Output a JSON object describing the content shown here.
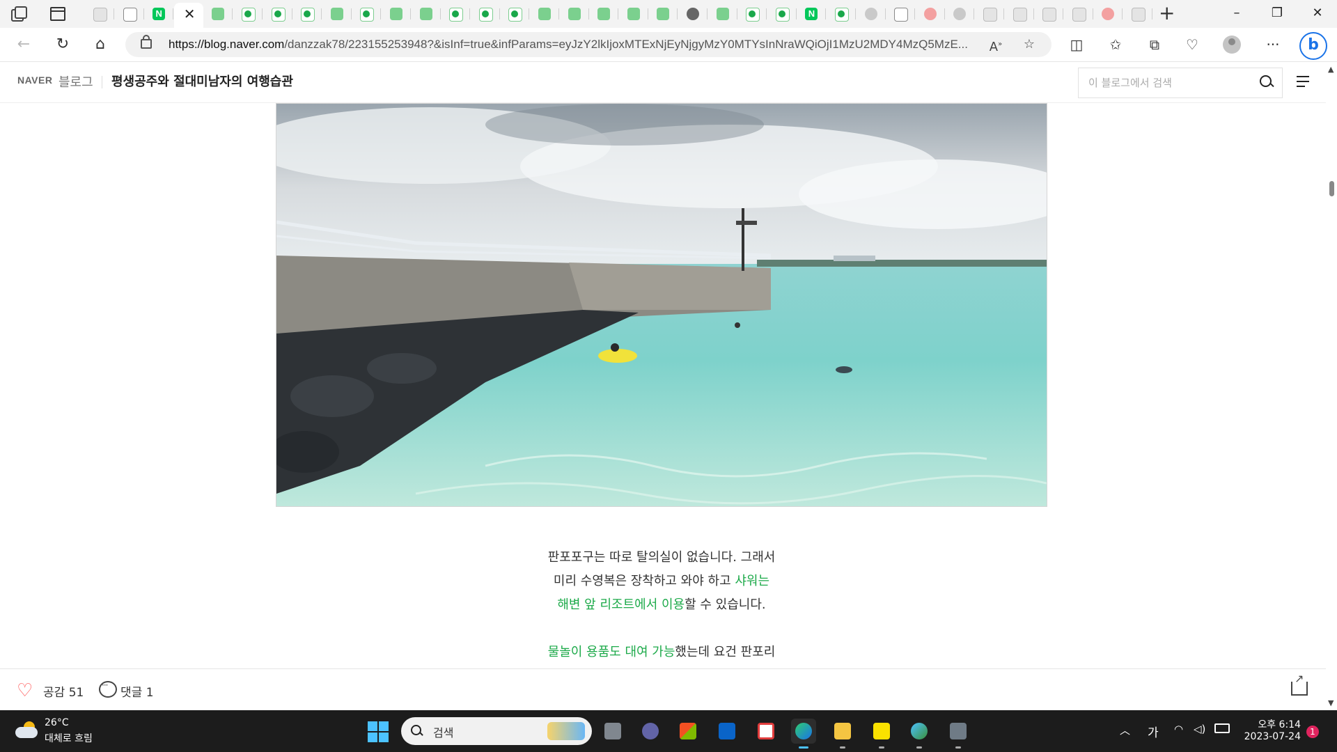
{
  "browser": {
    "tabs": [
      {
        "icon": "bookmark-icon",
        "kind": "ghost"
      },
      {
        "icon": "edu-icon",
        "kind": "doc"
      },
      {
        "icon": "naver-icon",
        "kind": "n"
      },
      {
        "icon": "close-icon",
        "kind": "active"
      },
      {
        "icon": "blog-icon",
        "kind": "bloggreen"
      },
      {
        "icon": "blog-icon",
        "kind": "blog"
      },
      {
        "icon": "blog-icon",
        "kind": "blog"
      },
      {
        "icon": "blog-icon",
        "kind": "blog"
      },
      {
        "icon": "blog-icon",
        "kind": "bloggreen"
      },
      {
        "icon": "blog-icon",
        "kind": "blog"
      },
      {
        "icon": "blog-icon",
        "kind": "bloggreen"
      },
      {
        "icon": "blog-icon",
        "kind": "bloggreen"
      },
      {
        "icon": "blog-icon",
        "kind": "blog"
      },
      {
        "icon": "blog-icon",
        "kind": "blog"
      },
      {
        "icon": "blog-icon",
        "kind": "blog"
      },
      {
        "icon": "blog-icon",
        "kind": "bloggreen"
      },
      {
        "icon": "blog-icon",
        "kind": "bloggreen"
      },
      {
        "icon": "blog-icon",
        "kind": "bloggreen"
      },
      {
        "icon": "blog-icon",
        "kind": "bloggreen"
      },
      {
        "icon": "blog-icon",
        "kind": "bloggreen"
      },
      {
        "icon": "slash-icon",
        "kind": "dark"
      },
      {
        "icon": "blog-icon",
        "kind": "bloggreen"
      },
      {
        "icon": "blog-icon",
        "kind": "blog"
      },
      {
        "icon": "blog-icon",
        "kind": "blog"
      },
      {
        "icon": "naver-icon",
        "kind": "n"
      },
      {
        "icon": "blog-icon",
        "kind": "blog"
      },
      {
        "icon": "anchor-icon",
        "kind": "gray"
      },
      {
        "icon": "document-icon",
        "kind": "doc"
      },
      {
        "icon": "t-icon",
        "kind": "pink"
      },
      {
        "icon": "gpt-icon",
        "kind": "gray"
      },
      {
        "icon": "speaker-icon",
        "kind": "ghost"
      },
      {
        "icon": "wave-icon",
        "kind": "ghost"
      },
      {
        "icon": "wave-icon",
        "kind": "ghost"
      },
      {
        "icon": "wave-icon",
        "kind": "ghost"
      },
      {
        "icon": "t-icon",
        "kind": "pink"
      },
      {
        "icon": "gradient-icon",
        "kind": "ghost"
      }
    ],
    "url_host": "https://blog.naver.com",
    "url_rest": "/danzzak78/223155253948?&isInf=true&infParams=eyJzY2lkIjoxMTExNjEyNjgyMzY0MTYsInNraWQiOjI1MzU2MDY4MzQ5MzE..."
  },
  "blog": {
    "logo": "NAVER",
    "blog_word": "블로그",
    "title": "평생공주와 절대미남자의 여행습관",
    "search_placeholder": "이 블로그에서 검색"
  },
  "post": {
    "paragraph1_line1": "판포포구는 따로 탈의실이 없습니다. 그래서",
    "paragraph1_line2_plain": "미리 수영복은 장착하고 와야 하고 ",
    "paragraph1_line2_hl": "샤워는",
    "paragraph1_line3_hl": "해변 앞 리조트에서 이용",
    "paragraph1_line3_plain": "할 수 있습니다.",
    "paragraph2_hl": "물놀이 용품도 대여 가능",
    "paragraph2_plain": "했는데 요건 판포리"
  },
  "footer": {
    "like_label": "공감",
    "like_count": "51",
    "comment_label": "댓글",
    "comment_count": "1"
  },
  "taskbar": {
    "temp": "26°C",
    "weather": "대체로 흐림",
    "search_label": "검색",
    "ime": "가",
    "time": "오후 6:14",
    "date": "2023-07-24",
    "notifications": "1"
  },
  "colors": {
    "accent_green": "#1daa4a",
    "like_red": "#ff5a5a"
  }
}
